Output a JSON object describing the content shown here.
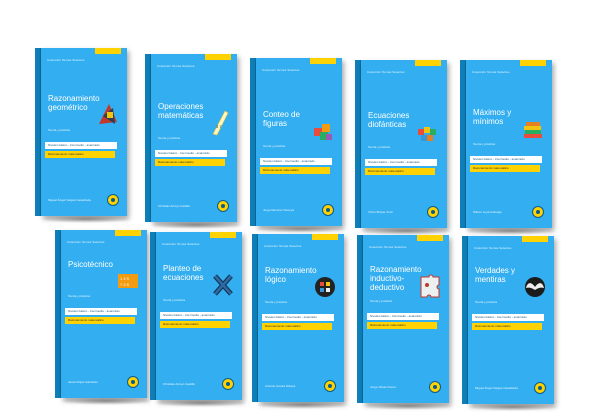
{
  "books": [
    {
      "collection": "Colección Temas Selectos",
      "title": "Razonamiento geométrico",
      "subtitle": "Teoría y práctica",
      "levels": "Niveles básico - intermedio - avanzado",
      "series": "Razonamiento matemático",
      "author": "Miguel Ángel Vargas Castañeda",
      "icon": "geometry-figure-icon"
    },
    {
      "collection": "Colección Temas Selectos",
      "title": "Operaciones matemáticas",
      "subtitle": "Teoría y práctica",
      "levels": "Niveles básico - intermedio - avanzado",
      "series": "Razonamiento matemático",
      "author": "Christian Arroyo Castillo",
      "icon": "numbers-ribbon-icon"
    },
    {
      "collection": "Colección Temas Selectos",
      "title": "Conteo de figuras",
      "subtitle": "Teoría y práctica",
      "levels": "Niveles básico - intermedio - avanzado",
      "series": "Razonamiento matemático",
      "author": "Jorge Ramírez Piscoya",
      "icon": "cubes-icon"
    },
    {
      "collection": "Colección Temas Selectos",
      "title": "Ecuaciones diofánticas",
      "subtitle": "Teoría y práctica",
      "levels": "Niveles básico - intermedio - avanzado",
      "series": "Razonamiento matemático",
      "author": "Víctor Borjas Yoza",
      "icon": "letter-blocks-icon"
    },
    {
      "collection": "Colección Temas Selectos",
      "title": "Máximos y mínimos",
      "subtitle": "Teoría y práctica",
      "levels": "Niveles básico - intermedio - avanzado",
      "series": "Razonamiento matemático",
      "author": "Wilson Luya Antiango",
      "icon": "stacked-books-icon"
    },
    {
      "collection": "Colección Temas Selectos",
      "title": "Psicotécnico",
      "subtitle": "Teoría y práctica",
      "levels": "Niveles básico - intermedio - avanzado",
      "series": "Razonamiento matemático",
      "author": "Jesús Rojas Garcilazo",
      "icon": "symbols-grid-icon"
    },
    {
      "collection": "Colección Temas Selectos",
      "title": "Planteo de ecuaciones",
      "subtitle": "Teoría y práctica",
      "levels": "Niveles básico - intermedio - avanzado",
      "series": "Razonamiento matemático",
      "author": "Christian Arroyo Castillo",
      "icon": "x-variable-icon"
    },
    {
      "collection": "Colección Temas Selectos",
      "title": "Razonamiento lógico",
      "subtitle": "Teoría y práctica",
      "levels": "Niveles básico - intermedio - avanzado",
      "series": "Razonamiento matemático",
      "author": "Antonio Acosta Olivera",
      "icon": "logic-sphere-icon"
    },
    {
      "collection": "Colección Temas Selectos",
      "title": "Razonamiento inductivo-deductivo",
      "subtitle": "Teoría y práctica",
      "levels": "Niveles básico - intermedio - avanzado",
      "series": "Razonamiento matemático",
      "author": "Jorge Olivas Flores",
      "icon": "puzzle-icon"
    },
    {
      "collection": "Colección Temas Selectos",
      "title": "Verdades y mentiras",
      "subtitle": "Teoría y práctica",
      "levels": "Niveles básico - intermedio - avanzado",
      "series": "Razonamiento matemático",
      "author": "Miguel Ángel Vargas Castañeda",
      "icon": "wings-icon"
    }
  ],
  "colors": {
    "cover": "#33aef0",
    "spine": "#0e7fb8",
    "accent": "#ffd200"
  }
}
